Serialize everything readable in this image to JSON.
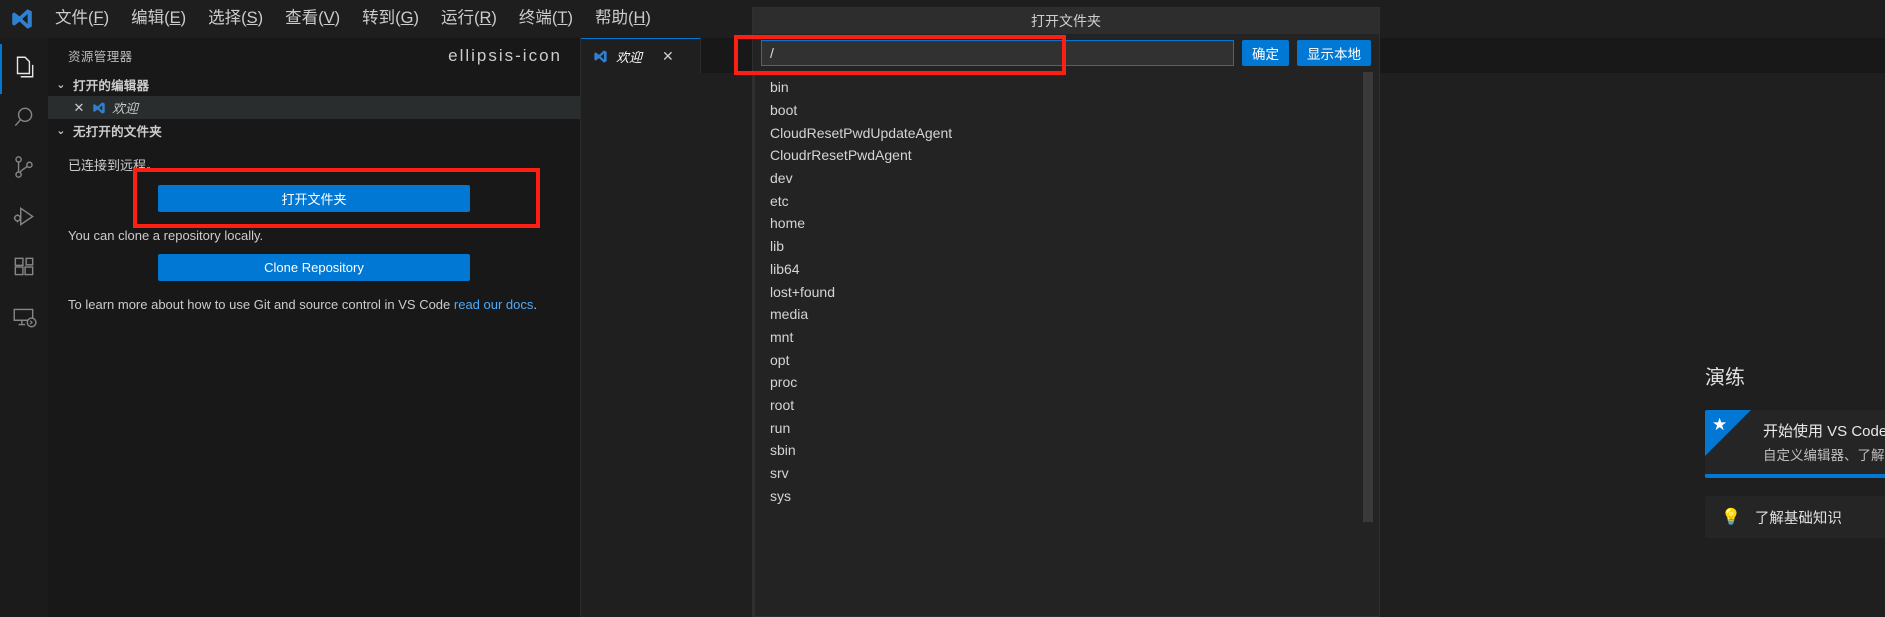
{
  "window": {
    "logo_icon": "vscode-logo-icon"
  },
  "menubar": {
    "items": [
      {
        "label": "文件(F)",
        "mnemonic": "F"
      },
      {
        "label": "编辑(E)",
        "mnemonic": "E"
      },
      {
        "label": "选择(S)",
        "mnemonic": "S"
      },
      {
        "label": "查看(V)",
        "mnemonic": "V"
      },
      {
        "label": "转到(G)",
        "mnemonic": "G"
      },
      {
        "label": "运行(R)",
        "mnemonic": "R"
      },
      {
        "label": "终端(T)",
        "mnemonic": "T"
      },
      {
        "label": "帮助(H)",
        "mnemonic": "H"
      }
    ]
  },
  "activitybar": {
    "items": [
      {
        "name": "explorer",
        "icon": "files-icon",
        "active": true
      },
      {
        "name": "search",
        "icon": "search-icon",
        "active": false
      },
      {
        "name": "source-control",
        "icon": "source-control-icon",
        "active": false
      },
      {
        "name": "run-and-debug",
        "icon": "run-debug-icon",
        "active": false
      },
      {
        "name": "extensions",
        "icon": "extensions-icon",
        "active": false
      },
      {
        "name": "remote-explorer",
        "icon": "remote-explorer-icon",
        "active": false
      }
    ]
  },
  "sidebar": {
    "title": "资源管理器",
    "more_actions_icon": "ellipsis-icon",
    "open_editors": {
      "label": "打开的编辑器",
      "chevron": "⌄",
      "items": [
        {
          "label": "欢迎",
          "close_icon": "✕",
          "file_icon": "vscode-logo-icon",
          "selected": true
        }
      ]
    },
    "no_folder": {
      "label": "无打开的文件夹",
      "chevron": "⌄",
      "connected_text": "已连接到远程。",
      "open_folder_button": "打开文件夹",
      "clone_text": "You can clone a repository locally.",
      "clone_button": "Clone Repository",
      "docs_text_before": "To learn more about how to use Git and source control in VS Code ",
      "docs_link": "read our docs",
      "docs_text_after": "."
    }
  },
  "editor": {
    "tabs": [
      {
        "label": "欢迎",
        "icon": "vscode-logo-icon",
        "close_icon": "✕",
        "active": true
      }
    ]
  },
  "welcome": {
    "walkthroughs_title": "演练",
    "cards": [
      {
        "title": "开始使用 VS Code",
        "subtitle": "自定义编辑器、了解基",
        "ribbon_icon": "star-icon",
        "progress_percent": 75
      }
    ],
    "items": [
      {
        "label": "了解基础知识",
        "icon": "lightbulb-icon"
      }
    ]
  },
  "dialog": {
    "title": "打开文件夹",
    "path_value": "/",
    "path_placeholder": "",
    "confirm_button": "确定",
    "local_button": "显示本地",
    "entries": [
      "bin",
      "boot",
      "CloudResetPwdUpdateAgent",
      "CloudrResetPwdAgent",
      "dev",
      "etc",
      "home",
      "lib",
      "lib64",
      "lost+found",
      "media",
      "mnt",
      "opt",
      "proc",
      "root",
      "run",
      "sbin",
      "srv",
      "sys"
    ]
  },
  "annotations": {
    "boxes": [
      {
        "name": "open-folder-button-highlight",
        "color": "#fb2013"
      },
      {
        "name": "path-input-highlight",
        "color": "#fb2013"
      }
    ]
  },
  "colors": {
    "accent": "#0078d4",
    "highlight": "#fb2013",
    "link": "#4daafc",
    "background": "#1e1e1e",
    "sidebar_bg": "#181818"
  }
}
